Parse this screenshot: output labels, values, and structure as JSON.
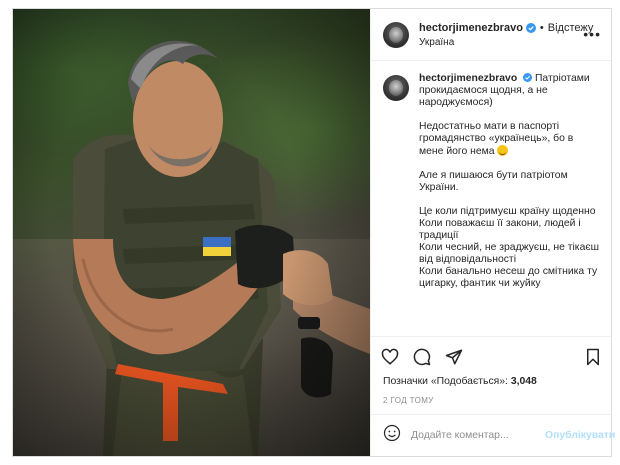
{
  "post": {
    "username": "hectorjimenezbravo",
    "follow_label": "Відстежу",
    "location": "Україна",
    "more_icon": "more-horizontal-icon",
    "caption": {
      "username": "hectorjimenezbravo",
      "p1": "Патріотами прокидаємося щодня, а не народжуємося)",
      "p2": "Недостатньо мати в паспорті громадянство «українець», бо в мене його нема",
      "p3": "Але я пишаюся бути патріотом України.",
      "p4_l1": "Це коли підтримуєш країну щоденно",
      "p4_l2": "Коли поважаєш її закони, людей і традиції",
      "p4_l3": "Коли чесний, не зраджуєш, не тікаєш від відповідальності",
      "p4_l4": "Коли банально несеш до смітника ту цигарку, фантик чи жуйку"
    },
    "likes_label": "Позначки «Подобається»:",
    "likes_count": "3,048",
    "time_ago": "2 ГОД ТОМУ",
    "comment_placeholder": "Додайте коментар...",
    "publish_label": "Опублікувати"
  },
  "colors": {
    "verified": "#3897f0",
    "publish_disabled": "#b2dffc",
    "muted": "#8e8e8e"
  },
  "icons": [
    "heart-icon",
    "comment-icon",
    "share-icon",
    "save-icon",
    "emoji-icon",
    "verified-badge-icon"
  ]
}
